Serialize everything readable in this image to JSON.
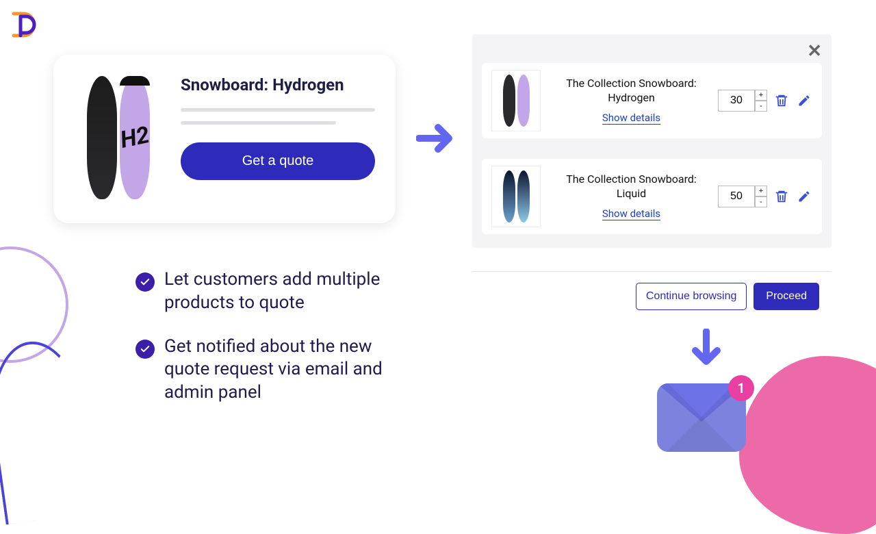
{
  "product": {
    "title": "Snowboard: Hydrogen",
    "cta": "Get a quote"
  },
  "quote": {
    "close": "✕",
    "items": [
      {
        "name": "The Collection Snowboard: Hydrogen",
        "details": "Show details",
        "qty": "30"
      },
      {
        "name": "The Collection Snowboard: Liquid",
        "details": "Show details",
        "qty": "50"
      }
    ],
    "continue": "Continue browsing",
    "proceed": "Proceed"
  },
  "features": {
    "f1": "Let customers add multiple products to quote",
    "f2": "Get notified about the new quote request via email and admin panel"
  },
  "notification_badge": "1",
  "colors": {
    "accent": "#2e2bba",
    "link": "#1b42c2",
    "badge": "#e83fa0"
  }
}
